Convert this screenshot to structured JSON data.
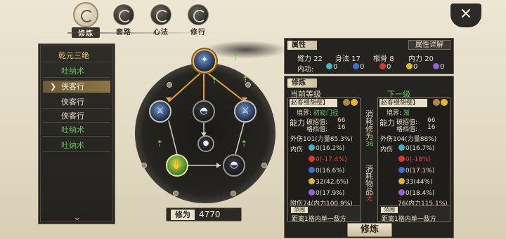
{
  "tabs": [
    {
      "label": "修炼",
      "active": true,
      "icon": "cultivate-icon"
    },
    {
      "label": "套路",
      "active": false,
      "icon": "routine-icon"
    },
    {
      "label": "心法",
      "active": false,
      "icon": "mind-method-icon"
    },
    {
      "label": "修行",
      "active": false,
      "icon": "practice-icon"
    }
  ],
  "close_label": "✕",
  "skill_list": {
    "title": "乾元三绝",
    "items": [
      {
        "label": "吐纳术",
        "color": "green"
      },
      {
        "label": "侠客行",
        "color": "white",
        "selected": true
      },
      {
        "label": "侠客行",
        "color": "white"
      },
      {
        "label": "侠客行",
        "color": "white"
      },
      {
        "label": "吐纳术",
        "color": "green"
      },
      {
        "label": "吐纳术",
        "color": "green"
      }
    ]
  },
  "xiuwei": {
    "label": "修为",
    "value": "4770"
  },
  "attributes": {
    "title": "属性",
    "detail_button": "属性详解",
    "stats": [
      {
        "name": "臂力",
        "value": "22"
      },
      {
        "name": "身法",
        "value": "17"
      },
      {
        "name": "根骨",
        "value": "8"
      },
      {
        "name": "内力",
        "value": "20"
      }
    ],
    "neigong_label": "内功:",
    "neigong": [
      {
        "color": "#3fb8c4",
        "value": "0"
      },
      {
        "color": "#3a6fd8",
        "value": "0"
      },
      {
        "color": "#d8392f",
        "value": "0"
      },
      {
        "color": "#e2b62c",
        "value": "0"
      },
      {
        "color": "#9a5fd0",
        "value": "0"
      }
    ]
  },
  "cultivate": {
    "title": "修炼",
    "current_label": "当前等级",
    "next_label": "下一级",
    "middle": {
      "top": "消耗修为",
      "cost": "36",
      "bottom": "消耗物品",
      "bottom_mark": "无"
    },
    "current": {
      "name": "赵客缦胡缨】",
      "realm_label": "境界:",
      "realm_value": "初窥门径",
      "ability_label": "能力",
      "break_label": "破招值:",
      "break_value": "66",
      "parry_label": "格挡值:",
      "parry_value": "16",
      "outer": "外伤101(力量85.3%)",
      "inner_label": "内伤",
      "lines": [
        {
          "text": "0(16.2%)",
          "color": "#3fb8c4",
          "cls": "white"
        },
        {
          "text": "0(-17.4%)",
          "color": "#d8392f",
          "cls": "red"
        },
        {
          "text": "0(16.6%)",
          "color": "#3a6fd8",
          "cls": "white"
        },
        {
          "text": "32(42.6%)",
          "color": "#e2b62c",
          "cls": "white"
        },
        {
          "text": "0(17.9%)",
          "color": "#9a5fd0",
          "cls": "white"
        }
      ],
      "attach": "附伤74(内力100.9%)",
      "range_label": "范围",
      "range_text": "距离1格内单一敌方"
    },
    "next": {
      "name": "赵客缦胡缨】",
      "realm_label": "境界:",
      "realm_value": "渐",
      "ability_label": "能力",
      "break_label": "破招值:",
      "break_value": "66",
      "parry_label": "格挡值:",
      "parry_value": "16",
      "outer": "外伤104(力量88%)",
      "inner_label": "内伤",
      "lines": [
        {
          "text": "0(16.7%)",
          "color": "#3fb8c4",
          "cls": "white"
        },
        {
          "text": "0(-18%)",
          "color": "#d8392f",
          "cls": "red"
        },
        {
          "text": "0(17.1%)",
          "color": "#3a6fd8",
          "cls": "white"
        },
        {
          "text": "33(44%)",
          "color": "#e2b62c",
          "cls": "white"
        },
        {
          "text": "0(18.4%)",
          "color": "#9a5fd0",
          "cls": "white"
        }
      ],
      "attach": "76(内力115.1%)",
      "range_label": "范围",
      "range_text": "距离1格内单一敌方"
    },
    "button": "修炼"
  }
}
